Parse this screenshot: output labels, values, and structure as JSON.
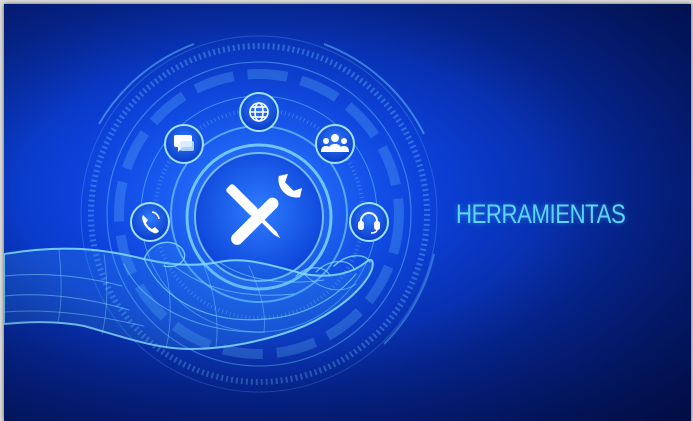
{
  "headline": "HERRAMIENTAS",
  "colors": {
    "background_center": "#1a5cff",
    "background_edge": "#021663",
    "accent_cyan": "#5ad6ff",
    "icon_white": "#ffffff"
  },
  "center_icon": "wrench-screwdriver-icon",
  "orbit_icons": [
    "phone-icon",
    "chat-icon",
    "globe-icon",
    "team-icon",
    "headset-icon"
  ],
  "foreground": "wireframe-hand"
}
